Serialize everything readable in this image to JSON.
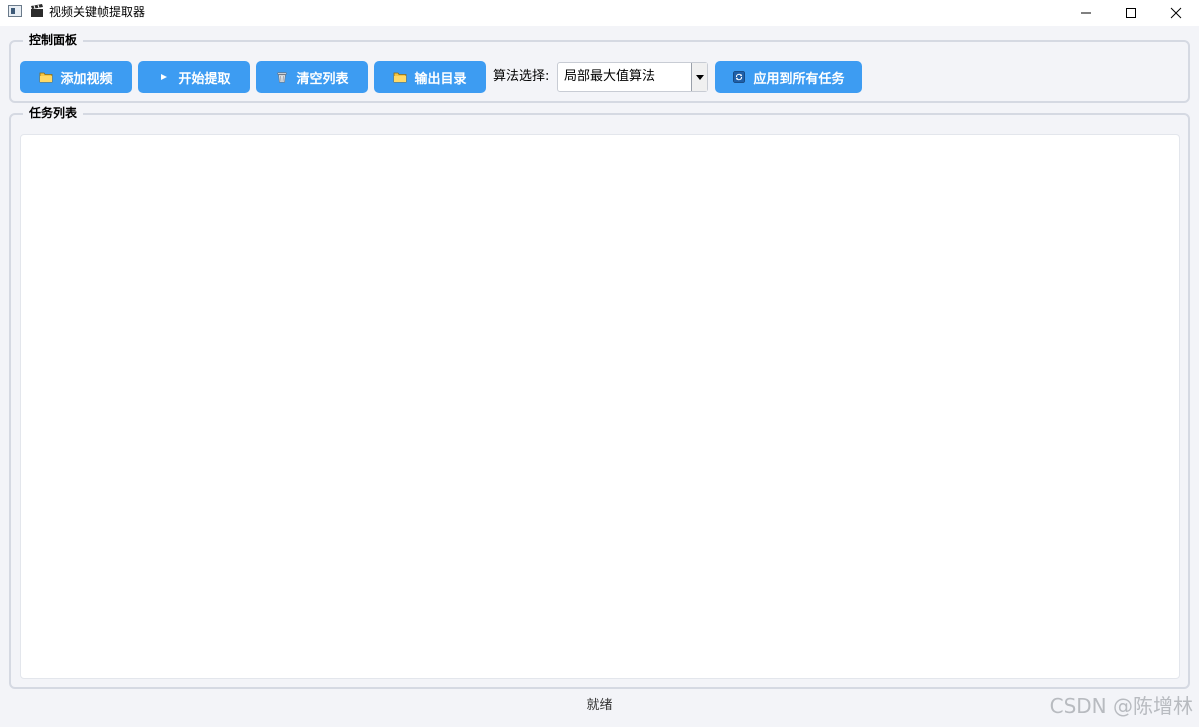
{
  "window": {
    "title": "视频关键帧提取器",
    "icons": [
      "app-window-icon",
      "clapperboard-icon",
      "minimize-icon",
      "maximize-icon",
      "close-icon"
    ]
  },
  "control_panel": {
    "title": "控制面板",
    "buttons": {
      "add_video": {
        "label": "添加视频",
        "icon": "folder-icon"
      },
      "start_extract": {
        "label": "开始提取",
        "icon": "play-icon"
      },
      "clear_list": {
        "label": "清空列表",
        "icon": "trash-icon"
      },
      "output_dir": {
        "label": "输出目录",
        "icon": "folder-icon"
      },
      "apply_all": {
        "label": "应用到所有任务",
        "icon": "refresh-icon"
      }
    },
    "algorithm": {
      "label": "算法选择:",
      "selected": "局部最大值算法"
    }
  },
  "task_panel": {
    "title": "任务列表"
  },
  "status_bar": {
    "text": "就绪"
  },
  "watermark": "CSDN @陈增林",
  "colors": {
    "button_bg": "#3d9cf2",
    "window_bg": "#f3f4f8",
    "border": "#d5d9e2"
  }
}
